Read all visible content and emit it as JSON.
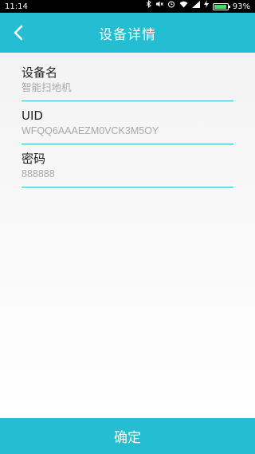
{
  "status_bar": {
    "time": "11:14",
    "battery_text": "93%",
    "battery_level": 0.93,
    "icons": [
      "bluetooth-icon",
      "mute-icon",
      "alarm-icon",
      "wifi-icon",
      "signal-icon",
      "charging-icon",
      "battery-icon"
    ]
  },
  "header": {
    "title": "设备详情",
    "back_icon": "chevron-left-icon"
  },
  "fields": [
    {
      "label": "设备名",
      "value": "智能扫地机"
    },
    {
      "label": "UID",
      "value": "WFQQ6AAAEZM0VCK3M5OY"
    },
    {
      "label": "密码",
      "value": "888888"
    }
  ],
  "confirm_button": {
    "label": "确定"
  },
  "colors": {
    "accent": "#24bdd2",
    "underline": "#2fb7cc",
    "value_text": "#a8a8a8"
  }
}
